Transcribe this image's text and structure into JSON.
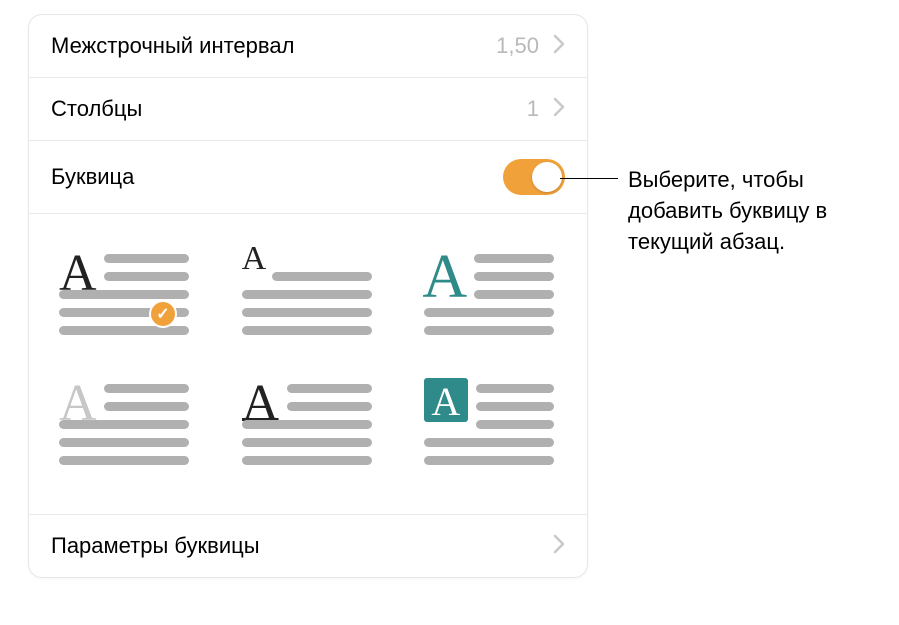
{
  "rows": {
    "lineSpacing": {
      "label": "Межстрочный интервал",
      "value": "1,50"
    },
    "columns": {
      "label": "Столбцы",
      "value": "1"
    },
    "dropCap": {
      "label": "Буквица"
    },
    "dropCapOptions": {
      "label": "Параметры буквицы"
    }
  },
  "callout": {
    "text": "Выберите, чтобы добавить буквицу в текущий абзац."
  },
  "icons": {
    "checkmark": "✓"
  },
  "styles": {
    "letterA": "A"
  }
}
